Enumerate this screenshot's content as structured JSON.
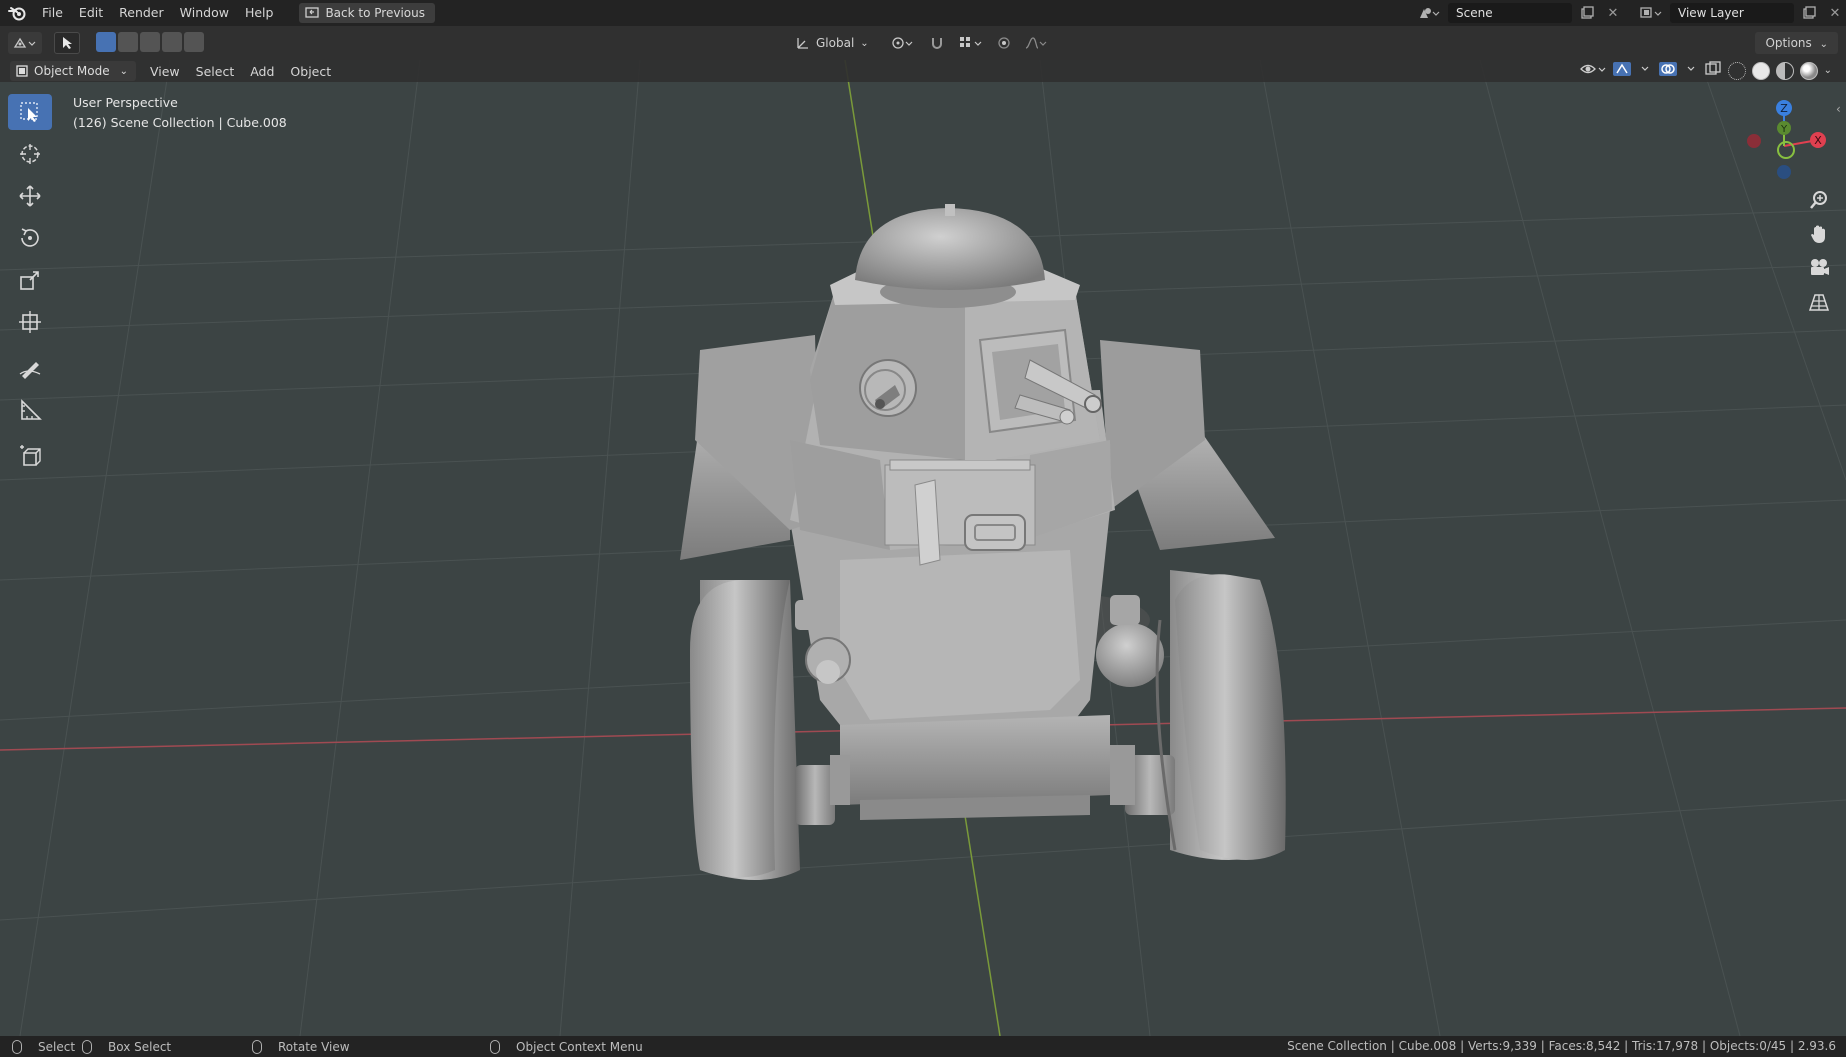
{
  "menubar": {
    "items": [
      "File",
      "Edit",
      "Render",
      "Window",
      "Help"
    ],
    "back_label": "Back to Previous",
    "scene_label": "Scene",
    "view_layer_label": "View Layer"
  },
  "toolheader": {
    "orientation": "Global",
    "options_label": "Options"
  },
  "viewport_header": {
    "mode": "Object Mode",
    "menus": [
      "View",
      "Select",
      "Add",
      "Object"
    ]
  },
  "viewport": {
    "perspective": "User Perspective",
    "collection_info": "(126) Scene Collection | Cube.008"
  },
  "gizmo": {
    "z_label": "Z",
    "x_label": "X",
    "y_label": "Y"
  },
  "tools": [
    "select-box-icon",
    "cursor-icon",
    "move-icon",
    "rotate-icon",
    "scale-icon",
    "transform-icon",
    "annotate-icon",
    "measure-icon",
    "add-cube-icon"
  ],
  "statusbar": {
    "select": "Select",
    "box_select": "Box Select",
    "rotate_view": "Rotate View",
    "context_menu": "Object Context Menu",
    "stats": "Scene Collection | Cube.008 | Verts:9,339 | Faces:8,542 | Tris:17,978 | Objects:0/45 | 2.93.6"
  },
  "colors": {
    "accent": "#4772b3",
    "viewport_bg": "#3c4444",
    "axis_x": "#e04050",
    "axis_y": "#88c040",
    "axis_z": "#3a80e0"
  }
}
